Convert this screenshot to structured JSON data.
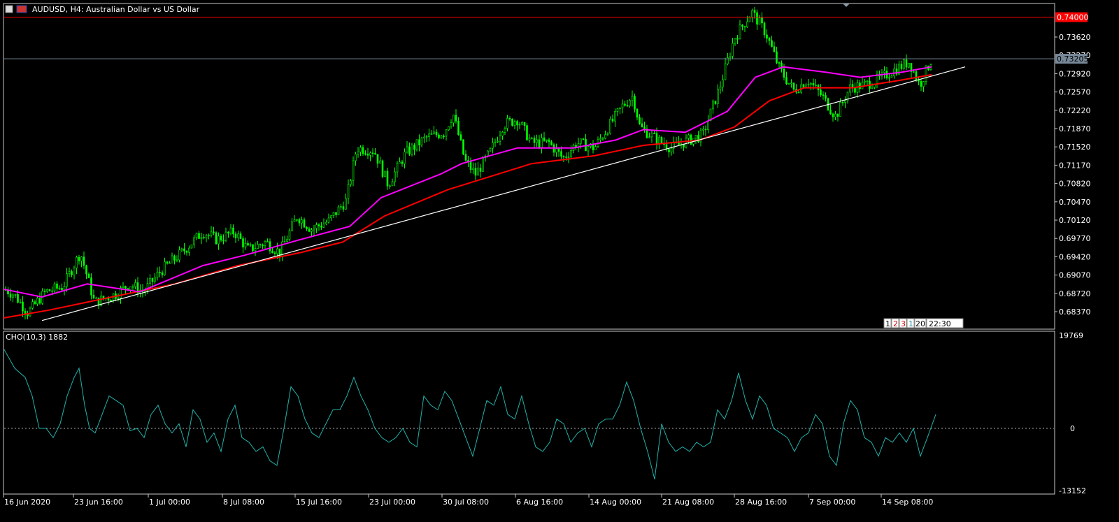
{
  "header": {
    "symbol": "AUDUSD",
    "timeframe": "H4",
    "description": "Australian Dollar vs US Dollar"
  },
  "price_panel": {
    "y_ticks": [
      "0.73620",
      "0.72920",
      "0.72570",
      "0.72220",
      "0.71870",
      "0.71520",
      "0.71170",
      "0.70820",
      "0.70470",
      "0.70120",
      "0.69770",
      "0.69420",
      "0.69070",
      "0.68720",
      "0.68370"
    ],
    "marker_level": "0.74000",
    "last_price": "0.73205",
    "partial_tick": "0.73270",
    "period_buttons": [
      "1",
      "2",
      "3",
      "1",
      "20",
      "22:30"
    ],
    "colors": {
      "bull": "#00ff00",
      "bear": "#00ff00",
      "ma_fast": "#ff00ff",
      "ma_slow": "#ff0000",
      "trendline": "#ffffff",
      "marker": "#ff0000",
      "last_price": "#778899"
    }
  },
  "indicator_panel": {
    "label": "CHO(10,3) 1882",
    "y_max": "19769",
    "y_zero": "0",
    "y_min": "-13152",
    "color": "#20b2aa"
  },
  "x_axis": {
    "labels": [
      "16 Jun 2020",
      "23 Jun 16:00",
      "1 Jul 00:00",
      "8 Jul 08:00",
      "15 Jul 16:00",
      "23 Jul 00:00",
      "30 Jul 08:00",
      "6 Aug 16:00",
      "14 Aug 00:00",
      "21 Aug 08:00",
      "28 Aug 16:00",
      "7 Sep 00:00",
      "14 Sep 08:00"
    ]
  },
  "chart_data": [
    {
      "type": "candlestick",
      "title": "AUDUSD, H4: Australian Dollar vs US Dollar",
      "ylim": [
        0.682,
        0.742
      ],
      "price_anchors": [
        [
          0,
          0.6885
        ],
        [
          20,
          0.687
        ],
        [
          40,
          0.6835
        ],
        [
          65,
          0.6875
        ],
        [
          90,
          0.6885
        ],
        [
          115,
          0.695
        ],
        [
          135,
          0.6855
        ],
        [
          165,
          0.687
        ],
        [
          185,
          0.689
        ],
        [
          205,
          0.6875
        ],
        [
          230,
          0.6915
        ],
        [
          260,
          0.695
        ],
        [
          290,
          0.699
        ],
        [
          310,
          0.6975
        ],
        [
          335,
          0.699
        ],
        [
          355,
          0.6955
        ],
        [
          380,
          0.697
        ],
        [
          400,
          0.695
        ],
        [
          425,
          0.702
        ],
        [
          445,
          0.6995
        ],
        [
          470,
          0.701
        ],
        [
          495,
          0.705
        ],
        [
          510,
          0.715
        ],
        [
          535,
          0.7145
        ],
        [
          555,
          0.708
        ],
        [
          580,
          0.714
        ],
        [
          610,
          0.717
        ],
        [
          635,
          0.718
        ],
        [
          648,
          0.7215
        ],
        [
          665,
          0.7125
        ],
        [
          680,
          0.71
        ],
        [
          700,
          0.714
        ],
        [
          720,
          0.7195
        ],
        [
          740,
          0.7205
        ],
        [
          760,
          0.716
        ],
        [
          785,
          0.716
        ],
        [
          805,
          0.713
        ],
        [
          825,
          0.716
        ],
        [
          850,
          0.715
        ],
        [
          870,
          0.719
        ],
        [
          890,
          0.723
        ],
        [
          905,
          0.725
        ],
        [
          915,
          0.719
        ],
        [
          940,
          0.7165
        ],
        [
          960,
          0.715
        ],
        [
          985,
          0.7165
        ],
        [
          1005,
          0.7175
        ],
        [
          1030,
          0.727
        ],
        [
          1050,
          0.736
        ],
        [
          1075,
          0.741
        ],
        [
          1095,
          0.737
        ],
        [
          1115,
          0.73
        ],
        [
          1135,
          0.726
        ],
        [
          1155,
          0.728
        ],
        [
          1175,
          0.725
        ],
        [
          1195,
          0.721
        ],
        [
          1215,
          0.7265
        ],
        [
          1235,
          0.727
        ],
        [
          1255,
          0.728
        ],
        [
          1280,
          0.73
        ],
        [
          1300,
          0.7315
        ],
        [
          1315,
          0.727
        ],
        [
          1332,
          0.732
        ]
      ],
      "ma_fast": [
        [
          5,
          0.688
        ],
        [
          60,
          0.6865
        ],
        [
          125,
          0.689
        ],
        [
          200,
          0.6875
        ],
        [
          290,
          0.6925
        ],
        [
          350,
          0.6945
        ],
        [
          430,
          0.6975
        ],
        [
          500,
          0.7
        ],
        [
          545,
          0.7055
        ],
        [
          630,
          0.71
        ],
        [
          660,
          0.712
        ],
        [
          740,
          0.715
        ],
        [
          820,
          0.715
        ],
        [
          880,
          0.7165
        ],
        [
          920,
          0.7185
        ],
        [
          980,
          0.718
        ],
        [
          1040,
          0.722
        ],
        [
          1080,
          0.7285
        ],
        [
          1120,
          0.7305
        ],
        [
          1180,
          0.7295
        ],
        [
          1230,
          0.7285
        ],
        [
          1290,
          0.7295
        ],
        [
          1332,
          0.7305
        ]
      ],
      "ma_slow": [
        [
          5,
          0.6825
        ],
        [
          70,
          0.684
        ],
        [
          160,
          0.6865
        ],
        [
          250,
          0.689
        ],
        [
          340,
          0.6925
        ],
        [
          430,
          0.695
        ],
        [
          490,
          0.697
        ],
        [
          550,
          0.702
        ],
        [
          640,
          0.707
        ],
        [
          700,
          0.7095
        ],
        [
          760,
          0.712
        ],
        [
          850,
          0.7135
        ],
        [
          920,
          0.7155
        ],
        [
          1000,
          0.7165
        ],
        [
          1050,
          0.719
        ],
        [
          1100,
          0.724
        ],
        [
          1150,
          0.7265
        ],
        [
          1220,
          0.7265
        ],
        [
          1290,
          0.728
        ],
        [
          1332,
          0.729
        ]
      ],
      "trendline": [
        [
          60,
          0.682
        ],
        [
          1380,
          0.7305
        ]
      ],
      "marker_value": 0.74,
      "last_value": 0.73205
    },
    {
      "type": "line",
      "title": "CHO(10,3) 1882",
      "ylim": [
        -13152,
        19769
      ],
      "zero_line": true,
      "points": [
        [
          0,
          17000
        ],
        [
          15,
          13000
        ],
        [
          30,
          11000
        ],
        [
          40,
          7000
        ],
        [
          50,
          0
        ],
        [
          60,
          0
        ],
        [
          70,
          -2000
        ],
        [
          80,
          1000
        ],
        [
          90,
          7000
        ],
        [
          100,
          11000
        ],
        [
          107,
          13000
        ],
        [
          115,
          5000
        ],
        [
          122,
          0
        ],
        [
          130,
          -1000
        ],
        [
          140,
          3000
        ],
        [
          150,
          7000
        ],
        [
          160,
          6000
        ],
        [
          170,
          5000
        ],
        [
          180,
          -500
        ],
        [
          190,
          0
        ],
        [
          200,
          -2000
        ],
        [
          210,
          3000
        ],
        [
          220,
          5000
        ],
        [
          230,
          1000
        ],
        [
          240,
          -1000
        ],
        [
          250,
          1000
        ],
        [
          260,
          -4000
        ],
        [
          270,
          4000
        ],
        [
          280,
          2000
        ],
        [
          290,
          -3000
        ],
        [
          300,
          -1000
        ],
        [
          310,
          -5000
        ],
        [
          320,
          2000
        ],
        [
          330,
          5000
        ],
        [
          340,
          -2000
        ],
        [
          350,
          -3000
        ],
        [
          360,
          -5000
        ],
        [
          370,
          -4000
        ],
        [
          380,
          -7000
        ],
        [
          390,
          -8000
        ],
        [
          400,
          0
        ],
        [
          410,
          9000
        ],
        [
          420,
          7000
        ],
        [
          430,
          2000
        ],
        [
          440,
          -1000
        ],
        [
          450,
          -2000
        ],
        [
          460,
          1000
        ],
        [
          470,
          4000
        ],
        [
          480,
          4000
        ],
        [
          490,
          7000
        ],
        [
          500,
          11000
        ],
        [
          510,
          7000
        ],
        [
          520,
          4000
        ],
        [
          530,
          0
        ],
        [
          540,
          -2000
        ],
        [
          550,
          -3000
        ],
        [
          560,
          -2000
        ],
        [
          570,
          0
        ],
        [
          580,
          -3000
        ],
        [
          590,
          -4000
        ],
        [
          600,
          7000
        ],
        [
          610,
          5000
        ],
        [
          620,
          4000
        ],
        [
          630,
          8000
        ],
        [
          640,
          6000
        ],
        [
          650,
          2000
        ],
        [
          660,
          -2000
        ],
        [
          670,
          -6000
        ],
        [
          680,
          0
        ],
        [
          690,
          6000
        ],
        [
          700,
          5000
        ],
        [
          710,
          9000
        ],
        [
          720,
          3000
        ],
        [
          730,
          2000
        ],
        [
          740,
          7000
        ],
        [
          750,
          1000
        ],
        [
          760,
          -4000
        ],
        [
          770,
          -5000
        ],
        [
          780,
          -3000
        ],
        [
          790,
          2000
        ],
        [
          800,
          1000
        ],
        [
          810,
          -3000
        ],
        [
          820,
          -1000
        ],
        [
          830,
          0
        ],
        [
          840,
          -4000
        ],
        [
          850,
          1000
        ],
        [
          860,
          2000
        ],
        [
          870,
          2000
        ],
        [
          880,
          5000
        ],
        [
          890,
          10000
        ],
        [
          900,
          6000
        ],
        [
          910,
          0
        ],
        [
          920,
          -5000
        ],
        [
          930,
          -11000
        ],
        [
          940,
          1000
        ],
        [
          950,
          -3000
        ],
        [
          960,
          -5000
        ],
        [
          970,
          -4000
        ],
        [
          980,
          -5000
        ],
        [
          990,
          -3000
        ],
        [
          1000,
          -4000
        ],
        [
          1010,
          -3000
        ],
        [
          1020,
          4000
        ],
        [
          1030,
          2000
        ],
        [
          1040,
          6000
        ],
        [
          1050,
          12000
        ],
        [
          1060,
          6000
        ],
        [
          1070,
          2000
        ],
        [
          1080,
          7000
        ],
        [
          1090,
          5000
        ],
        [
          1100,
          0
        ],
        [
          1110,
          -1000
        ],
        [
          1120,
          -2000
        ],
        [
          1130,
          -5000
        ],
        [
          1140,
          -2000
        ],
        [
          1150,
          -1000
        ],
        [
          1160,
          3000
        ],
        [
          1170,
          1000
        ],
        [
          1180,
          -6000
        ],
        [
          1190,
          -8000
        ],
        [
          1200,
          1000
        ],
        [
          1210,
          6000
        ],
        [
          1220,
          4000
        ],
        [
          1230,
          -2000
        ],
        [
          1240,
          -3000
        ],
        [
          1250,
          -6000
        ],
        [
          1260,
          -2000
        ],
        [
          1270,
          -3000
        ],
        [
          1280,
          -1000
        ],
        [
          1290,
          -3000
        ],
        [
          1300,
          0
        ],
        [
          1310,
          -6000
        ],
        [
          1320,
          -2000
        ],
        [
          1332,
          3000
        ]
      ]
    }
  ]
}
